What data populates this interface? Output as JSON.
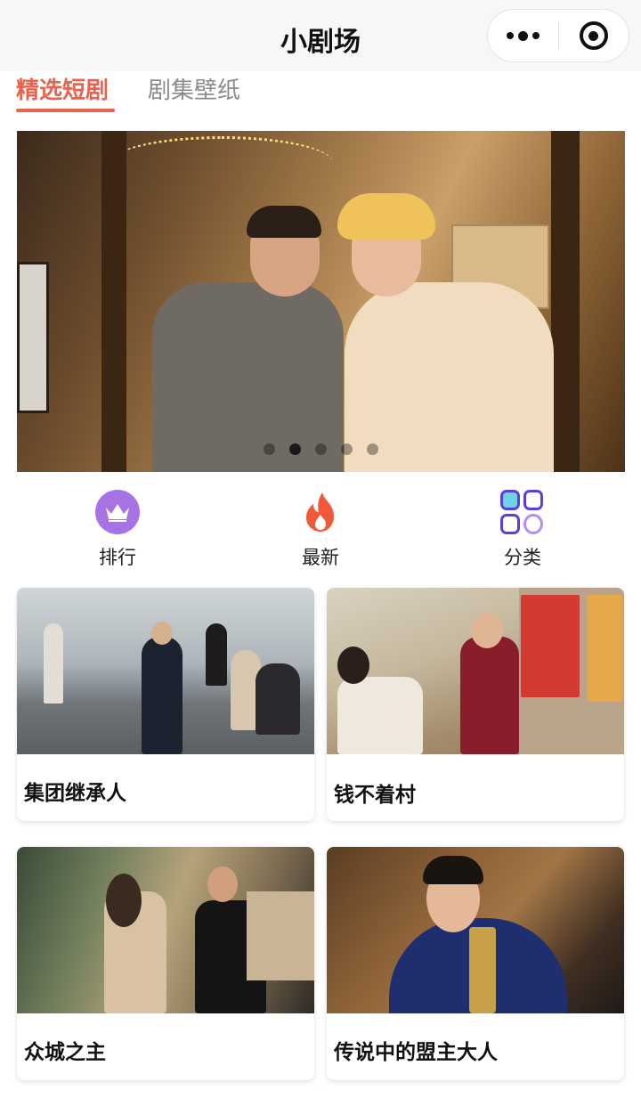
{
  "header": {
    "title": "小剧场"
  },
  "tabs": [
    {
      "label": "精选短剧",
      "active": true
    },
    {
      "label": "剧集壁纸",
      "active": false
    }
  ],
  "banner": {
    "dot_count": 5,
    "active_dot": 2
  },
  "quick_actions": [
    {
      "label": "排行",
      "icon": "crown-icon",
      "color": "#a772e3"
    },
    {
      "label": "最新",
      "icon": "flame-icon",
      "color": "#f0593c"
    },
    {
      "label": "分类",
      "icon": "category-grid-icon",
      "color": "#5b3fd6"
    }
  ],
  "cards": [
    {
      "title": "集团继承人"
    },
    {
      "title": "钱不着村"
    },
    {
      "title": "众城之主"
    },
    {
      "title": "传说中的盟主大人"
    }
  ],
  "colors": {
    "accent": "#e8644c",
    "tab_inactive": "#8b8b8b"
  }
}
